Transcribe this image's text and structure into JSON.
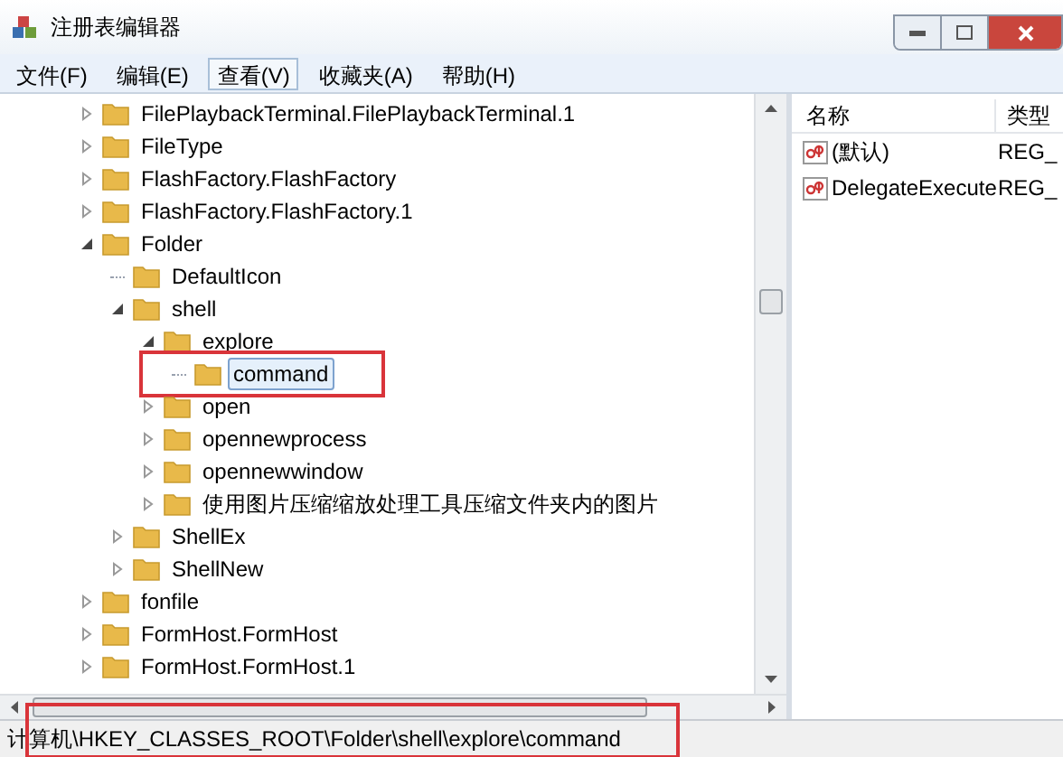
{
  "window": {
    "title": "注册表编辑器"
  },
  "menu": [
    {
      "label": "文件(F)",
      "selected": false
    },
    {
      "label": "编辑(E)",
      "selected": false
    },
    {
      "label": "查看(V)",
      "selected": true
    },
    {
      "label": "收藏夹(A)",
      "selected": false
    },
    {
      "label": "帮助(H)",
      "selected": false
    }
  ],
  "tree": [
    {
      "label": "FilePlaybackTerminal.FilePlaybackTerminal.1",
      "expanded": false,
      "selected": false
    },
    {
      "label": "FileType",
      "expanded": false,
      "selected": false
    },
    {
      "label": "FlashFactory.FlashFactory",
      "expanded": false,
      "selected": false
    },
    {
      "label": "FlashFactory.FlashFactory.1",
      "expanded": false,
      "selected": false
    },
    {
      "label": "Folder",
      "expanded": true,
      "selected": false,
      "children": [
        {
          "label": "DefaultIcon",
          "selected": false
        },
        {
          "label": "shell",
          "expanded": true,
          "selected": false,
          "children": [
            {
              "label": "explore",
              "expanded": true,
              "selected": false,
              "children": [
                {
                  "label": "command",
                  "selected": true,
                  "annotated": true
                }
              ]
            },
            {
              "label": "open",
              "expanded": false,
              "selected": false
            },
            {
              "label": "opennewprocess",
              "expanded": false,
              "selected": false
            },
            {
              "label": "opennewwindow",
              "expanded": false,
              "selected": false
            },
            {
              "label": "使用图片压缩缩放处理工具压缩文件夹内的图片",
              "expanded": false,
              "selected": false
            }
          ]
        },
        {
          "label": "ShellEx",
          "expanded": false,
          "selected": false
        },
        {
          "label": "ShellNew",
          "expanded": false,
          "selected": false
        }
      ]
    },
    {
      "label": "fonfile",
      "expanded": false,
      "selected": false
    },
    {
      "label": "FormHost.FormHost",
      "expanded": false,
      "selected": false
    },
    {
      "label": "FormHost.FormHost.1",
      "expanded": false,
      "selected": false
    }
  ],
  "values_table": {
    "columns": [
      "名称",
      "类型"
    ],
    "rows": [
      {
        "name": "(默认)",
        "type": "REG_"
      },
      {
        "name": "DelegateExecute",
        "type": "REG_"
      }
    ]
  },
  "status_bar": {
    "path": "计算机\\HKEY_CLASSES_ROOT\\Folder\\shell\\explore\\command",
    "annotated": true
  }
}
